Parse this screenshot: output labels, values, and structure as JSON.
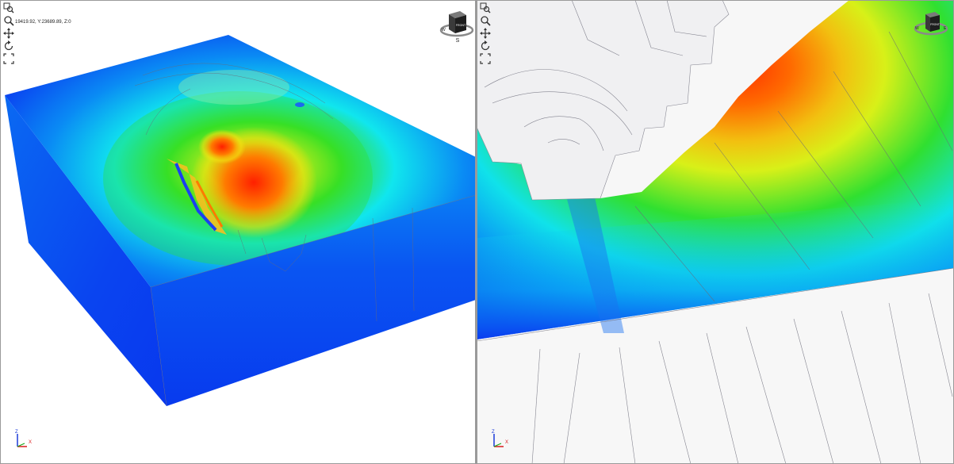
{
  "viewports": [
    {
      "id": "left",
      "coordinates": "19419.92, Y:23689.89, Z:0",
      "view_cube": {
        "face_label": "FRONT",
        "compass": [
          "W",
          "S"
        ]
      },
      "axes": [
        "Z",
        "X"
      ]
    },
    {
      "id": "right",
      "view_cube": {
        "face_label": "FRONT",
        "compass": [
          "W",
          "E"
        ]
      },
      "axes": [
        "Z",
        "X"
      ]
    }
  ],
  "colors": {
    "blue": "#0a3cf0",
    "cyan": "#10e6ee",
    "green": "#28e022",
    "yellow": "#f0f010",
    "orange": "#ff7a00",
    "red": "#ff2a00",
    "mesh_line": "#6a6a78"
  }
}
